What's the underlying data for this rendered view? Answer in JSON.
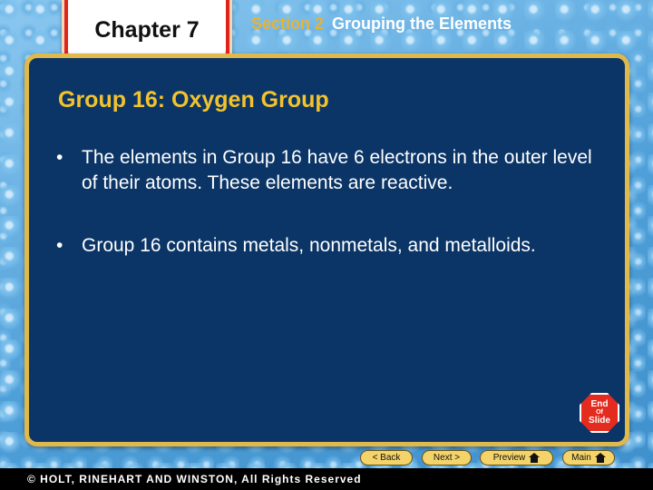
{
  "header": {
    "chapter": "Chapter 7",
    "section_label": "Section 2",
    "section_name": "Grouping the Elements"
  },
  "slide": {
    "title": "Group 16: Oxygen Group",
    "bullets": [
      "The elements in Group 16 have 6 electrons in the outer level of their atoms. These elements are reactive.",
      "Group 16 contains metals, nonmetals, and metalloids."
    ],
    "bullet_glyph": "•"
  },
  "end_button": {
    "line1": "End",
    "line2": "Of",
    "line3": "Slide"
  },
  "nav": {
    "back": "< Back",
    "next": "Next >",
    "preview": "Preview",
    "main": "Main"
  },
  "footer": {
    "copyright": "© HOLT, RINEHART AND WINSTON, All Rights Reserved"
  },
  "colors": {
    "panel": "#0b3566",
    "panel_border": "#e0b94a",
    "title": "#f3c32c",
    "tab_red": "#e2231a",
    "nav_button": "#f4d46a"
  }
}
